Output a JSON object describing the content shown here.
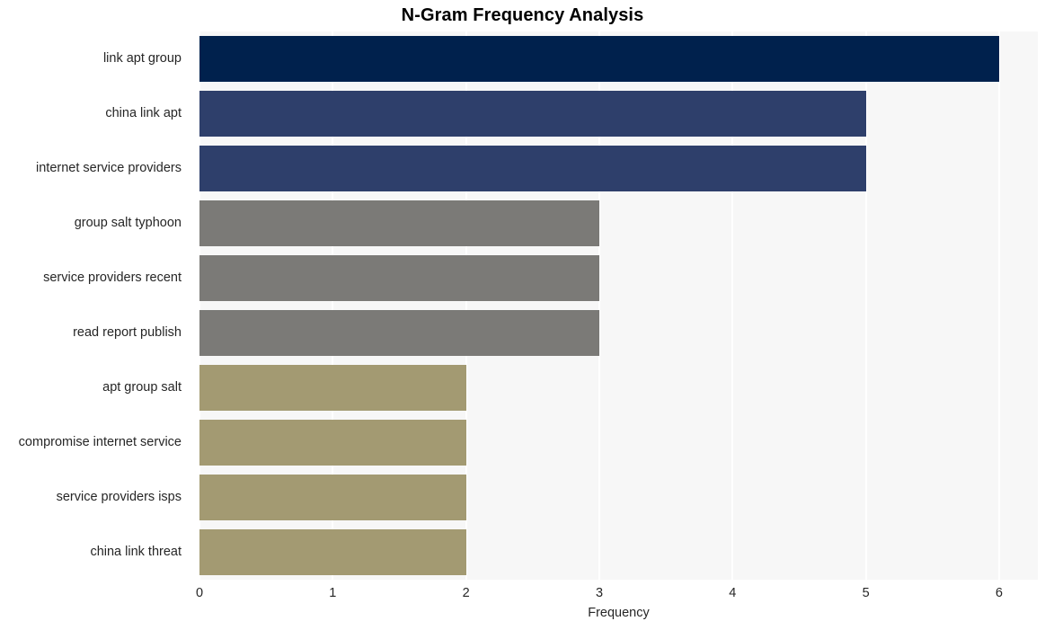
{
  "chart_data": {
    "type": "bar",
    "orientation": "horizontal",
    "title": "N-Gram Frequency Analysis",
    "xlabel": "Frequency",
    "ylabel": "",
    "categories": [
      "link apt group",
      "china link apt",
      "internet service providers",
      "group salt typhoon",
      "service providers recent",
      "read report publish",
      "apt group salt",
      "compromise internet service",
      "service providers isps",
      "china link threat"
    ],
    "values": [
      6,
      5,
      5,
      3,
      3,
      3,
      2,
      2,
      2,
      2
    ],
    "bar_colors": [
      "#00214d",
      "#2e3f6b",
      "#2e3f6b",
      "#7b7a77",
      "#7b7a77",
      "#7b7a77",
      "#a39a72",
      "#a39a72",
      "#a39a72",
      "#a39a72"
    ],
    "xlim": [
      0,
      6.29
    ],
    "xticks": [
      0,
      1,
      2,
      3,
      4,
      5,
      6
    ],
    "xtick_labels": [
      "0",
      "1",
      "2",
      "3",
      "4",
      "5",
      "6"
    ],
    "grid": "vertical",
    "grid_color": "#ffffff",
    "plot_background": "#f7f7f7",
    "figure_background": "#ffffff",
    "legend": "none",
    "text_color": "#262626",
    "title_color": "#000000"
  }
}
